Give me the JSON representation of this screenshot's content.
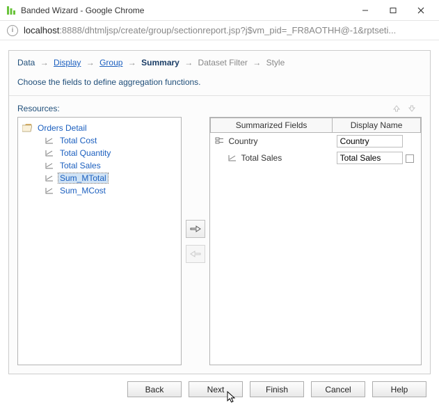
{
  "window": {
    "title": "Banded Wizard - Google Chrome"
  },
  "url": {
    "host": "localhost",
    "path": ":8888/dhtmljsp/create/group/sectionreport.jsp?j$vm_pid=_FR8AOTHH@-1&rptseti..."
  },
  "breadcrumb": {
    "steps": [
      {
        "label": "Data",
        "kind": "step"
      },
      {
        "label": "Display",
        "kind": "link"
      },
      {
        "label": "Group",
        "kind": "link"
      },
      {
        "label": "Summary",
        "kind": "current"
      },
      {
        "label": "Dataset Filter",
        "kind": "disabled"
      },
      {
        "label": "Style",
        "kind": "disabled"
      }
    ]
  },
  "instruction": "Choose the fields to define aggregation functions.",
  "resources_label": "Resources:",
  "tree": {
    "root": "Orders Detail",
    "fields": [
      {
        "label": "Total Cost",
        "selected": false
      },
      {
        "label": "Total Quantity",
        "selected": false
      },
      {
        "label": "Total Sales",
        "selected": false
      },
      {
        "label": "Sum_MTotal",
        "selected": true
      },
      {
        "label": "Sum_MCost",
        "selected": false
      }
    ]
  },
  "right_headers": {
    "col1": "Summarized Fields",
    "col2": "Display Name"
  },
  "right_rows": [
    {
      "type": "group",
      "field": "Country",
      "display": "Country",
      "checkbox": false
    },
    {
      "type": "field",
      "indent": true,
      "field": "Total Sales",
      "display": "Total Sales",
      "checkbox": true
    }
  ],
  "buttons": {
    "back": "Back",
    "next": "Next",
    "finish": "Finish",
    "cancel": "Cancel",
    "help": "Help"
  }
}
